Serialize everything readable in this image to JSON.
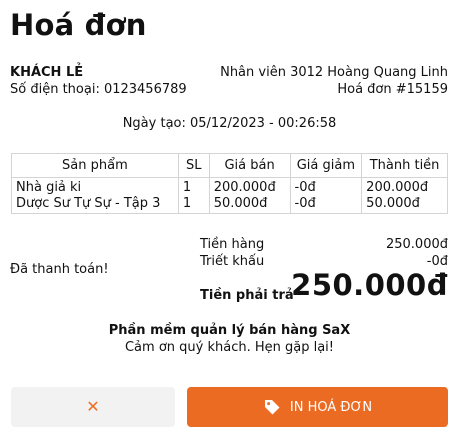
{
  "title": "Hoá đơn",
  "customer": {
    "name": "KHÁCH LẺ",
    "phone": "Số điện thoại: 0123456789"
  },
  "invoice": {
    "staff": "Nhân viên 3012 Hoàng Quang Linh",
    "number": "Hoá đơn #15159",
    "created": "Ngày tạo: 05/12/2023 - 00:26:58"
  },
  "table": {
    "headers": [
      "Sản phẩm",
      "SL",
      "Giá bán",
      "Giá giảm",
      "Thành tiền"
    ],
    "rows": [
      [
        "Nhà giả ki",
        "1",
        "200.000đ",
        "-0đ",
        "200.000đ"
      ],
      [
        "Dược Sư Tự Sự - Tập 3",
        "1",
        "50.000đ",
        "-0đ",
        "50.000đ"
      ]
    ]
  },
  "status": "Đã thanh toán!",
  "summary": {
    "subtotal_label": "Tiền hàng",
    "subtotal_value": "250.000đ",
    "discount_label": "Triết khấu",
    "discount_value": "-0đ",
    "total_label": "Tiền phải trả",
    "total_value": "250.000đ"
  },
  "footer": {
    "brand": "Phần mềm quản lý bán hàng SaX",
    "thanks": "Cảm ơn quý khách. Hẹn gặp lại!"
  },
  "buttons": {
    "cancel_icon": "close-icon",
    "print_icon": "tag-icon",
    "print_label": "IN HOÁ ĐƠN"
  },
  "colors": {
    "accent": "#ec6b22",
    "cancel_bg": "#f2f2f2"
  }
}
